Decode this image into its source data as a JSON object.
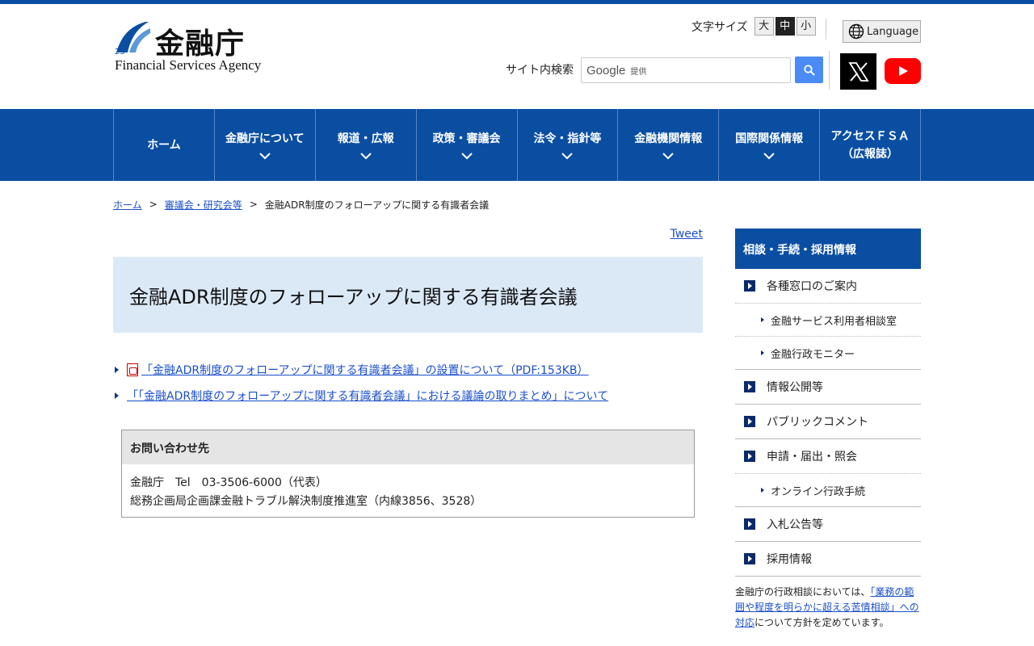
{
  "site": {
    "logo_kanji": "金融庁",
    "logo_en": "Financial Services Agency"
  },
  "header": {
    "font_size_label": "文字サイズ",
    "font_sizes": [
      "大",
      "中",
      "小"
    ],
    "font_size_selected": "中",
    "language_label": "Language",
    "search_label": "サイト内検索",
    "search_google": "Google",
    "search_provided": "提供"
  },
  "nav": {
    "items": [
      {
        "label": "ホーム"
      },
      {
        "label": "金融庁について"
      },
      {
        "label": "報道・広報"
      },
      {
        "label": "政策・審議会"
      },
      {
        "label": "法令・指針等"
      },
      {
        "label": "金融機関情報"
      },
      {
        "label": "国際関係情報"
      },
      {
        "label": "アクセスＦＳＡ\n（広報誌）"
      }
    ]
  },
  "breadcrumb": {
    "home": "ホーム",
    "parent": "審議会・研究会等",
    "current": "金融ADR制度のフォローアップに関する有識者会議"
  },
  "main": {
    "tweet": "Tweet",
    "title": "金融ADR制度のフォローアップに関する有識者会議",
    "links": [
      "「金融ADR制度のフォローアップに関する有識者会議」の設置について（PDF:153KB）",
      "「「金融ADR制度のフォローアップに関する有識者会議」における議論の取りまとめ」について"
    ],
    "contact": {
      "heading": "お問い合わせ先",
      "line1": "金融庁　Tel　03-3506-6000（代表）",
      "line2": "総務企画局企画課金融トラブル解決制度推進室（内線3856、3528）"
    }
  },
  "sidebar": {
    "heading": "相談・手続・採用情報",
    "items": [
      {
        "label": "各種窓口のご案内"
      },
      {
        "label": "金融サービス利用者相談室"
      },
      {
        "label": "金融行政モニター"
      },
      {
        "label": "情報公開等"
      },
      {
        "label": "パブリックコメント"
      },
      {
        "label": "申請・届出・照会"
      },
      {
        "label": "オンライン行政手続"
      },
      {
        "label": "入札公告等"
      },
      {
        "label": "採用情報"
      }
    ],
    "note_pre": "金融庁の行政相談においては、",
    "note_link": "「業務の範囲や程度を明らかに超える苦情相談」への対応",
    "note_post": "について方針を定めています。"
  },
  "colors": {
    "brand_blue": "#0a4ea2",
    "title_bg": "#dbe9f7",
    "link": "#1a4fc9"
  }
}
